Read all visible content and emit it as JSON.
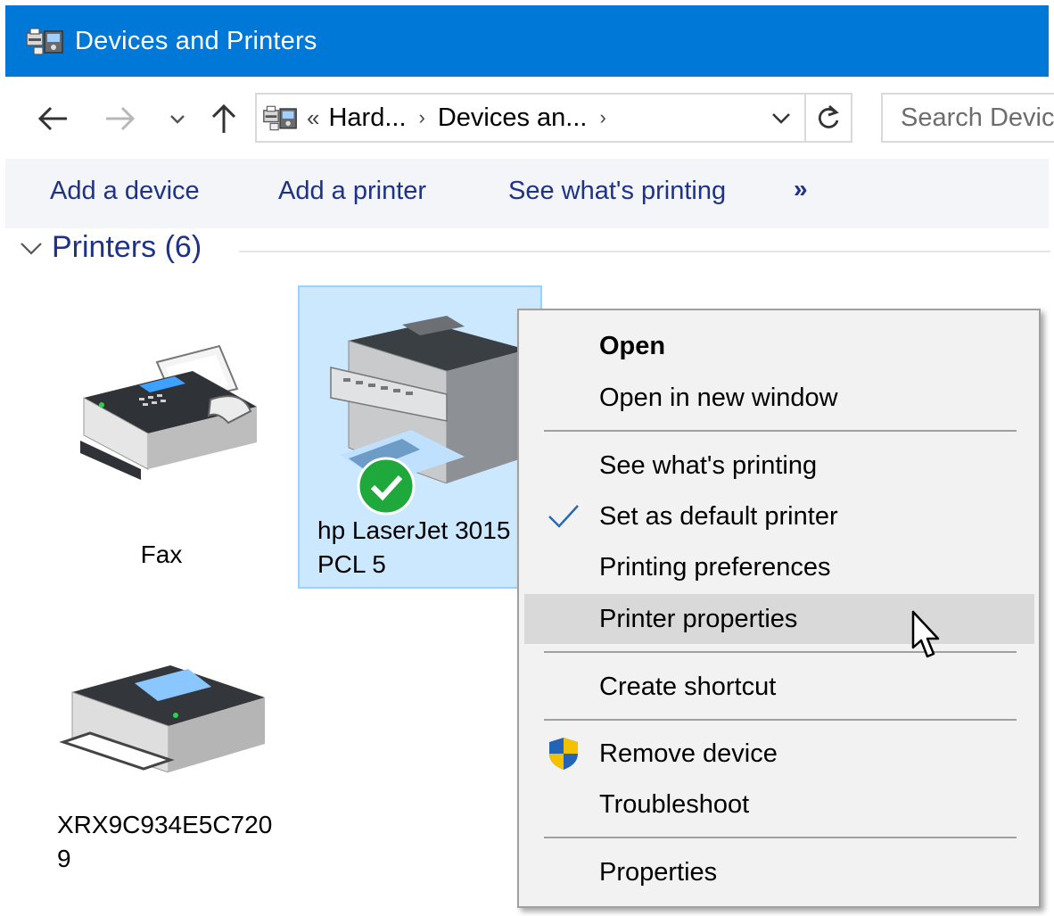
{
  "window": {
    "title": "Devices and Printers"
  },
  "nav": {
    "crumb_prefix": "«",
    "crumbs": [
      "Hard...",
      "Devices an..."
    ],
    "search_placeholder": "Search Devices and Printers"
  },
  "commands": {
    "add_device": "Add a device",
    "add_printer": "Add a printer",
    "see_printing": "See what's printing",
    "more": "»"
  },
  "group": {
    "title": "Printers (6)"
  },
  "devices": [
    {
      "label": "Fax"
    },
    {
      "label_line1": "hp LaserJet 3015",
      "label_line2": "PCL 5",
      "default": true,
      "selected": true
    },
    {
      "label_line1": "XRX9C934E5C720",
      "label_line2": "9"
    }
  ],
  "context_menu": {
    "open": "Open",
    "open_new_window": "Open in new window",
    "see_printing": "See what's printing",
    "set_default": "Set as default printer",
    "printing_preferences": "Printing preferences",
    "printer_properties": "Printer properties",
    "create_shortcut": "Create shortcut",
    "remove_device": "Remove device",
    "troubleshoot": "Troubleshoot",
    "properties": "Properties"
  },
  "colors": {
    "titlebar": "#0078d7",
    "link_text": "#1e3287",
    "selection": "#cce8ff",
    "default_badge": "#1fa93c"
  }
}
